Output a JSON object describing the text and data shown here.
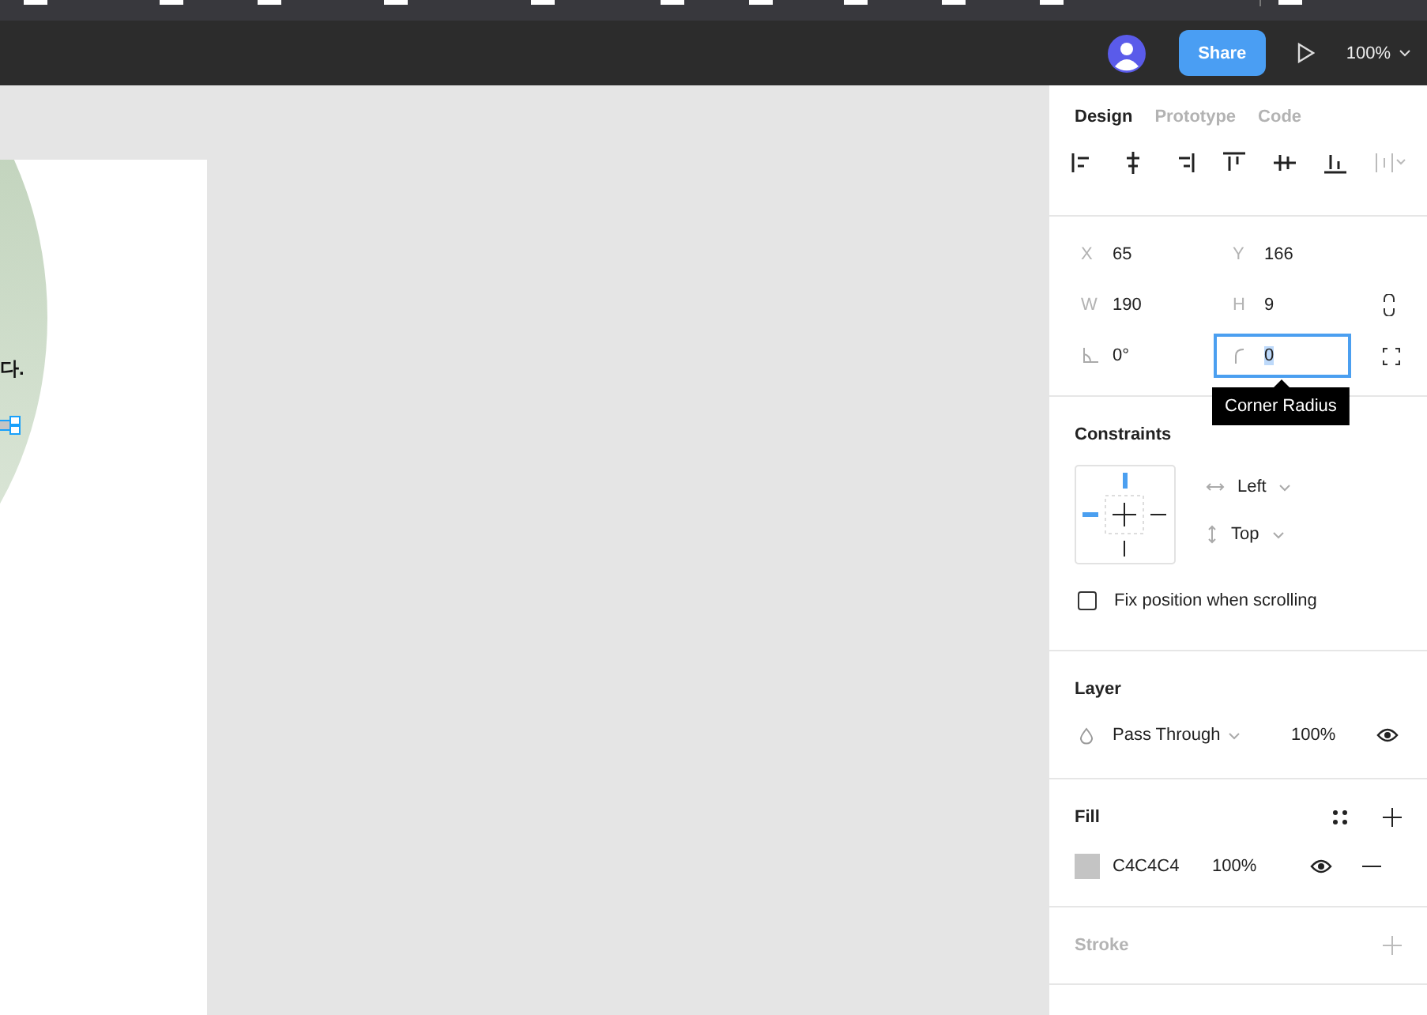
{
  "header": {
    "share_button": "Share",
    "zoom": "100%"
  },
  "canvas": {
    "frame_text": "다."
  },
  "tabs": [
    {
      "label": "Design",
      "selected": true
    },
    {
      "label": "Prototype",
      "selected": false
    },
    {
      "label": "Code",
      "selected": false
    }
  ],
  "align_tools": [
    {
      "kind": "left",
      "disabled": false
    },
    {
      "kind": "hcenter",
      "disabled": false
    },
    {
      "kind": "right",
      "disabled": false
    },
    {
      "kind": "top",
      "disabled": false
    },
    {
      "kind": "vcenter",
      "disabled": false
    },
    {
      "kind": "bottom",
      "disabled": false
    },
    {
      "kind": "distribute",
      "disabled": true
    }
  ],
  "properties": [
    [
      {
        "label": "X",
        "value": "65",
        "focused": false
      },
      {
        "label": "Y",
        "value": "166",
        "focused": false
      }
    ],
    [
      {
        "label": "W",
        "value": "190",
        "focused": false
      },
      {
        "label": "H",
        "value": "9",
        "focused": false
      }
    ],
    [
      {
        "value": "0°",
        "focused": false,
        "kind": "rotation"
      },
      {
        "value": "0",
        "focused": true,
        "kind": "radius"
      }
    ]
  ],
  "tooltip": "Corner Radius",
  "constraints": {
    "title": "Constraints",
    "horizontal": "Left",
    "vertical": "Top",
    "fix_position": {
      "label": "Fix position when scrolling",
      "checked": false
    }
  },
  "layer": {
    "title": "Layer",
    "blend": "Pass Through",
    "opacity": "100%",
    "visible": true
  },
  "fill": {
    "title": "Fill",
    "color": "#c4c4c4",
    "hex": "C4C4C4",
    "opacity": "100%",
    "visible": true
  },
  "stroke": {
    "title": "Stroke",
    "empty": true
  }
}
